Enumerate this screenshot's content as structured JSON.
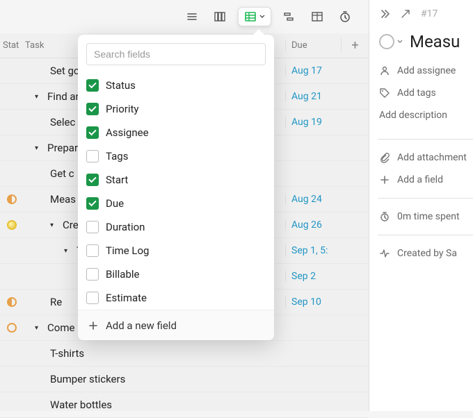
{
  "toolbar": {
    "icons": [
      "list-icon",
      "board-icon",
      "sheet-icon",
      "timeline-icon",
      "table-icon",
      "timer-icon"
    ]
  },
  "columns": {
    "stat": "Stat",
    "task": "Task",
    "due": "Due"
  },
  "tasks": [
    {
      "status": "",
      "title": "Set goal",
      "due": "Aug 17",
      "indent": 1,
      "caret": false
    },
    {
      "status": "",
      "title": "Find and",
      "due": "Aug 21",
      "indent": 0,
      "caret": true
    },
    {
      "status": "",
      "title": "Selec",
      "due": "Aug 19",
      "indent": 1,
      "caret": false
    },
    {
      "status": "",
      "title": "Preparati",
      "due": "",
      "indent": 0,
      "caret": true
    },
    {
      "status": "",
      "title": "Get c",
      "due": "",
      "indent": 1,
      "caret": false
    },
    {
      "status": "half-orange",
      "title": "Meas",
      "due": "Aug 24",
      "indent": 1,
      "caret": false
    },
    {
      "status": "full-yellow",
      "title": "Creat",
      "due": "Aug 26",
      "indent": 1,
      "caret": true
    },
    {
      "status": "",
      "title": "Ti",
      "due": "Sep 1, 5:",
      "indent": 2,
      "caret": true
    },
    {
      "status": "",
      "title": "",
      "due": "Sep 2",
      "indent": 2,
      "caret": false
    },
    {
      "status": "half-orange",
      "title": "Re",
      "due": "Sep 10",
      "indent": 1,
      "caret": false
    },
    {
      "status": "ring-orange",
      "title": "Come up",
      "due": "",
      "indent": 0,
      "caret": true
    },
    {
      "status": "",
      "title": "T-shirts",
      "due": "",
      "indent": 1,
      "caret": false
    },
    {
      "status": "",
      "title": "Bumper stickers",
      "due": "",
      "indent": 1,
      "caret": false
    },
    {
      "status": "",
      "title": "Water bottles",
      "due": "",
      "indent": 1,
      "caret": false
    }
  ],
  "dropdown": {
    "search_placeholder": "Search fields",
    "fields": [
      {
        "label": "Status",
        "checked": true
      },
      {
        "label": "Priority",
        "checked": true
      },
      {
        "label": "Assignee",
        "checked": true
      },
      {
        "label": "Tags",
        "checked": false
      },
      {
        "label": "Start",
        "checked": true
      },
      {
        "label": "Due",
        "checked": true
      },
      {
        "label": "Duration",
        "checked": false
      },
      {
        "label": "Time Log",
        "checked": false
      },
      {
        "label": "Billable",
        "checked": false
      },
      {
        "label": "Estimate",
        "checked": false
      }
    ],
    "add_new": "Add a new field"
  },
  "sidebar": {
    "breadcrumb_id": "#17",
    "title": "Measu",
    "assignee": "Add assignee",
    "tags": "Add tags",
    "description": "Add description",
    "attachment": "Add attachment",
    "add_field": "Add a field",
    "time_spent": "0m time spent",
    "created_by": "Created by Sa"
  }
}
